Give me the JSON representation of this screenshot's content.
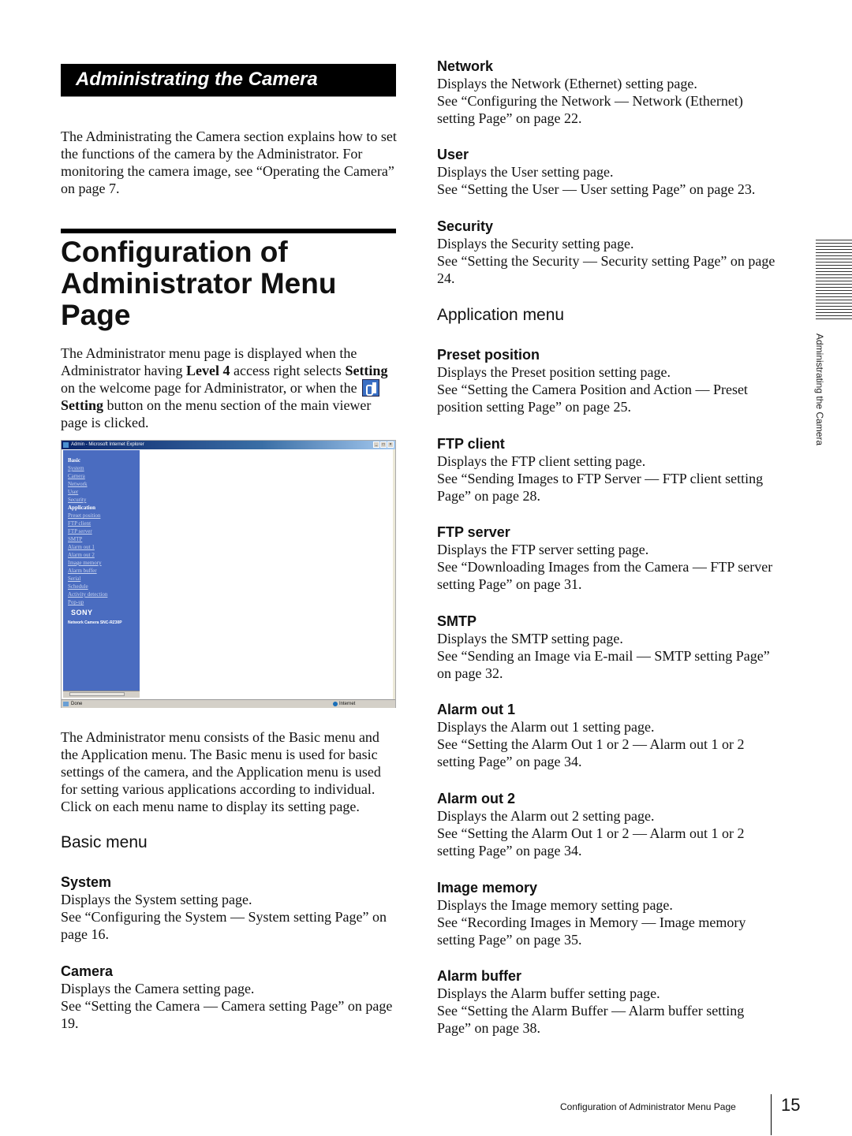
{
  "section_banner": "Administrating the Camera",
  "intro": "The Administrating the Camera section explains how to set the functions of the camera by the Administrator. For monitoring the camera image, see “Operating the Camera” on page 7.",
  "heading": "Configuration of Administrator Menu Page",
  "desc": {
    "p1a": "The Administrator menu page is displayed when the Administrator having ",
    "p1b": "Level 4",
    "p1c": " access right selects ",
    "p1d": "Setting",
    "p1e": " on the welcome page for Administrator, or when the ",
    "p1f": "Setting",
    "p1g": " button on the menu section of the main viewer page is clicked."
  },
  "browser": {
    "title": "Admin - Microsoft Internet Explorer",
    "controls": [
      "_",
      "□",
      "×"
    ],
    "basic_label": "Basic",
    "basic_items": [
      "System",
      "Camera",
      "Network",
      "User",
      "Security"
    ],
    "application_label": "Application",
    "application_items": [
      "Preset position",
      "FTP client",
      "FTP server",
      "SMTP",
      "Alarm out 1",
      "Alarm out 2",
      "Image memory",
      "Alarm buffer",
      "Serial",
      "Schedule",
      "Activity detection",
      "Pop-up"
    ],
    "brand": "SONY",
    "model": "Network Camera SNC-RZ30P",
    "status_left": "Done",
    "status_right": "Internet"
  },
  "menu_para": "The Administrator menu consists of the Basic menu and the Application menu.  The Basic menu is used for basic settings of the camera, and the Application menu is used for setting various applications according to individual. Click on each menu name to display its setting page.",
  "basic_menu": {
    "title": "Basic menu",
    "items": [
      {
        "name": "System",
        "line1": "Displays the System setting page.",
        "line2": "See “Configuring the System — System setting Page” on page 16."
      },
      {
        "name": "Camera",
        "line1": "Displays the Camera setting page.",
        "line2": "See “Setting the Camera — Camera setting Page” on page 19."
      },
      {
        "name": "Network",
        "line1": "Displays the Network (Ethernet) setting page.",
        "line2": "See “Configuring the Network — Network (Ethernet) setting Page” on page 22."
      },
      {
        "name": "User",
        "line1": "Displays the User setting page.",
        "line2": "See “Setting the User — User setting Page” on page 23."
      },
      {
        "name": "Security",
        "line1": "Displays the Security setting page.",
        "line2": "See “Setting the Security — Security setting Page” on page 24."
      }
    ]
  },
  "application_menu": {
    "title": "Application menu",
    "items": [
      {
        "name": "Preset position",
        "line1": "Displays the Preset position setting page.",
        "line2": "See “Setting the Camera Position and Action — Preset position setting Page” on page 25."
      },
      {
        "name": "FTP client",
        "line1": "Displays the FTP client setting page.",
        "line2": "See “Sending Images to FTP Server — FTP client setting Page” on page 28."
      },
      {
        "name": "FTP server",
        "line1": "Displays the FTP server setting page.",
        "line2": "See “Downloading Images from the Camera — FTP server setting Page” on page 31."
      },
      {
        "name": "SMTP",
        "line1": "Displays the SMTP setting page.",
        "line2": "See “Sending an Image via E-mail — SMTP setting Page” on page 32."
      },
      {
        "name": "Alarm out 1",
        "line1": "Displays the Alarm out 1 setting page.",
        "line2": "See “Setting the Alarm Out 1 or 2 — Alarm out 1 or 2 setting Page” on page 34."
      },
      {
        "name": "Alarm out 2",
        "line1": "Displays the Alarm out 2 setting page.",
        "line2": "See “Setting the Alarm Out 1 or 2 — Alarm out 1 or 2 setting Page” on page 34."
      },
      {
        "name": "Image memory",
        "line1": "Displays the Image memory setting page.",
        "line2": "See “Recording Images in Memory — Image memory setting Page” on page 35."
      },
      {
        "name": "Alarm buffer",
        "line1": "Displays the Alarm buffer setting page.",
        "line2": "See “Setting the Alarm Buffer — Alarm buffer setting Page” on page 38."
      }
    ]
  },
  "side_tab": "Administrating the Camera",
  "footer": {
    "text": "Configuration of Administrator Menu Page",
    "page": "15"
  }
}
